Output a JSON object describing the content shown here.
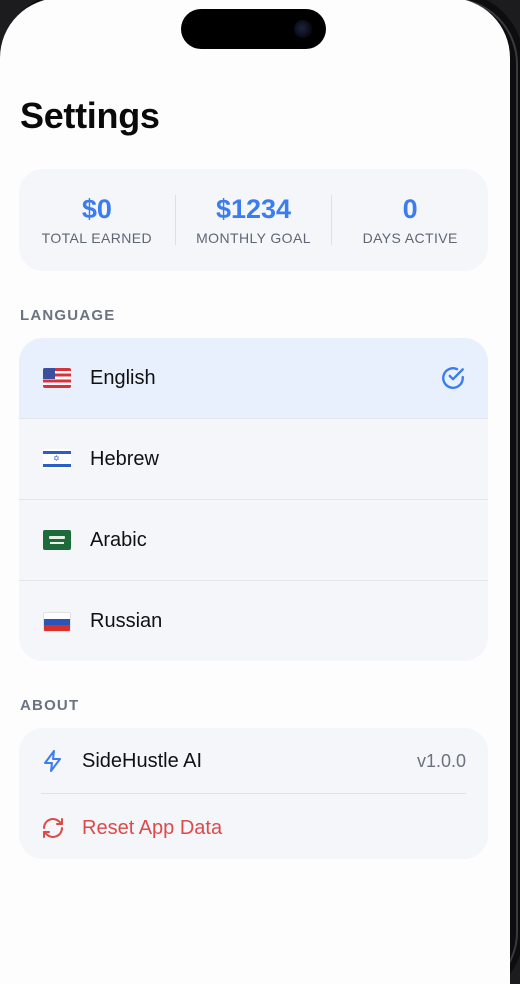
{
  "page": {
    "title": "Settings"
  },
  "stats": [
    {
      "value": "$0",
      "label": "TOTAL EARNED"
    },
    {
      "value": "$1234",
      "label": "MONTHLY GOAL"
    },
    {
      "value": "0",
      "label": "DAYS ACTIVE"
    }
  ],
  "language": {
    "section_label": "LANGUAGE",
    "selected": "English",
    "items": [
      {
        "label": "English",
        "flag": "us-flag"
      },
      {
        "label": "Hebrew",
        "flag": "israel-flag"
      },
      {
        "label": "Arabic",
        "flag": "saudi-arabia-flag"
      },
      {
        "label": "Russian",
        "flag": "russia-flag"
      }
    ]
  },
  "about": {
    "section_label": "ABOUT",
    "app_name": "SideHustle AI",
    "version": "v1.0.0",
    "reset_label": "Reset App Data"
  },
  "colors": {
    "accent": "#3b7cf0",
    "danger": "#dc4a4a",
    "selected_row": "#e9f0fd",
    "card_bg": "#f4f6f9"
  },
  "icons": {
    "check": "check-circle-icon",
    "app": "lightning-bolt-icon",
    "reset": "refresh-icon"
  }
}
